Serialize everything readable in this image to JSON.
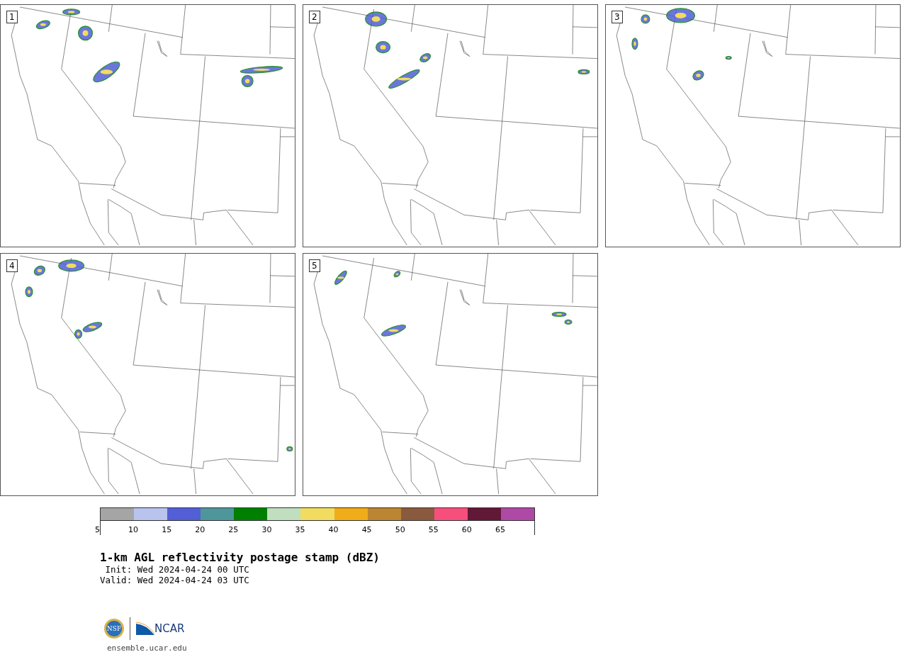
{
  "panels": [
    {
      "label": "1"
    },
    {
      "label": "2"
    },
    {
      "label": "3"
    },
    {
      "label": "4"
    },
    {
      "label": "5"
    }
  ],
  "colorbar": {
    "swatches": [
      {
        "color": "#a5a5a5"
      },
      {
        "color": "#b8c4ee"
      },
      {
        "color": "#525fd6"
      },
      {
        "color": "#4f969b"
      },
      {
        "color": "#008000"
      },
      {
        "color": "#bfdfbf"
      },
      {
        "color": "#f1dc5f"
      },
      {
        "color": "#f0ad19"
      },
      {
        "color": "#bb8531"
      },
      {
        "color": "#8a5a3e"
      },
      {
        "color": "#f64f7c"
      },
      {
        "color": "#621837"
      },
      {
        "color": "#ae4aa5"
      }
    ],
    "ticks": [
      "5",
      "10",
      "15",
      "20",
      "25",
      "30",
      "35",
      "40",
      "45",
      "50",
      "55",
      "60",
      "65"
    ]
  },
  "title": "1-km AGL reflectivity postage stamp (dBZ)",
  "init": " Init: Wed 2024-04-24 00 UTC",
  "valid": "Valid: Wed 2024-04-24 03 UTC",
  "logo": {
    "left": "NSF",
    "right": "NCAR"
  },
  "url": "ensemble.ucar.edu"
}
